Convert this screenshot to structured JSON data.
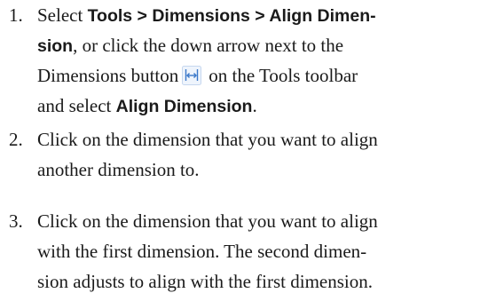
{
  "steps": [
    {
      "number": "1.",
      "lines": [
        [
          {
            "t": "Select ",
            "ui": false
          },
          {
            "t": "Tools > Dimensions > Align Dimen-",
            "ui": true
          }
        ],
        [
          {
            "t": "sion",
            "ui": true
          },
          {
            "t": ", or click the down arrow next to the",
            "ui": false
          }
        ],
        [
          {
            "t": "Dimensions button",
            "ui": false
          },
          {
            "icon": "align-dimension-icon"
          },
          {
            "t": "on the Tools toolbar",
            "ui": false
          }
        ],
        [
          {
            "t": "and select ",
            "ui": false
          },
          {
            "t": "Align Dimension",
            "ui": true
          },
          {
            "t": ".",
            "ui": false
          }
        ]
      ]
    },
    {
      "number": "2.",
      "lines": [
        [
          {
            "t": "Click on the dimension that you want to align",
            "ui": false
          }
        ],
        [
          {
            "t": "another dimension to.",
            "ui": false
          }
        ]
      ]
    },
    {
      "number": "3.",
      "lines": [
        [
          {
            "t": "Click on the dimension that you want to align",
            "ui": false
          }
        ],
        [
          {
            "t": "with the first dimension. The second dimen-",
            "ui": false
          }
        ],
        [
          {
            "t": "sion adjusts to align with the first dimension.",
            "ui": false
          }
        ]
      ]
    }
  ],
  "colors": {
    "text": "#1a1a1a",
    "icon_blue": "#3a78c9"
  }
}
